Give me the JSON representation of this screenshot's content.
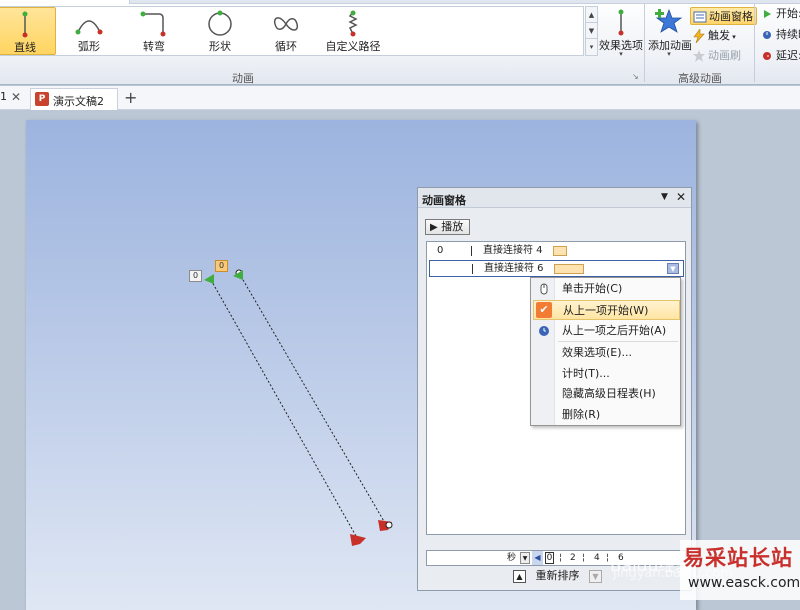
{
  "ribbon": {
    "gallery": [
      {
        "label": "直线",
        "icon": "line-path-icon",
        "selected": true
      },
      {
        "label": "弧形",
        "icon": "arc-path-icon",
        "selected": false
      },
      {
        "label": "转弯",
        "icon": "turn-path-icon",
        "selected": false
      },
      {
        "label": "形状",
        "icon": "shape-path-icon",
        "selected": false
      },
      {
        "label": "循环",
        "icon": "loop-path-icon",
        "selected": false
      },
      {
        "label": "自定义路径",
        "icon": "custom-path-icon",
        "selected": false
      }
    ],
    "effect_options_label": "效果选项",
    "animation_group_label": "动画",
    "add_animation_label": "添加动画",
    "animation_pane_label": "动画窗格",
    "trigger_label": "触发",
    "animation_painter_label": "动画刷",
    "advanced_group_label": "高级动画",
    "timing": {
      "start_label": "开始:",
      "duration_label": "持续时",
      "delay_label": "延迟:"
    }
  },
  "doc_tabs": {
    "fragment_label": "1",
    "tab_title": "演示文稿2",
    "add_tab": "+"
  },
  "slide": {
    "tags": [
      "0",
      "0"
    ]
  },
  "anim_pane": {
    "title": "动画窗格",
    "play_label": "播放",
    "items": [
      {
        "num": "0",
        "name": "直接连接符 4"
      },
      {
        "num": "",
        "name": "直接连接符 6"
      }
    ],
    "context_menu": [
      {
        "label": "单击开始(C)",
        "icon": "mouse-click-icon"
      },
      {
        "label": "从上一项开始(W)",
        "icon": "check-icon"
      },
      {
        "label": "从上一项之后开始(A)",
        "icon": "clock-icon"
      },
      {
        "label": "效果选项(E)..."
      },
      {
        "label": "计时(T)..."
      },
      {
        "label": "隐藏高级日程表(H)"
      },
      {
        "label": "删除(R)"
      }
    ],
    "timeline": {
      "unit": "秒",
      "ticks": [
        "0",
        "2",
        "4",
        "6"
      ]
    },
    "reorder_label": "重新排序"
  },
  "watermark": {
    "text1": "Baidu经验",
    "text2": "jingyan.baidu.com",
    "brand_cn": "易采站长站",
    "brand_url": "www.easck.com"
  },
  "colors": {
    "selection_orange": "#f27c33",
    "path_start_green": "#3fae3f",
    "path_end_red": "#c8302a",
    "slide_top": "#9cb4df"
  }
}
